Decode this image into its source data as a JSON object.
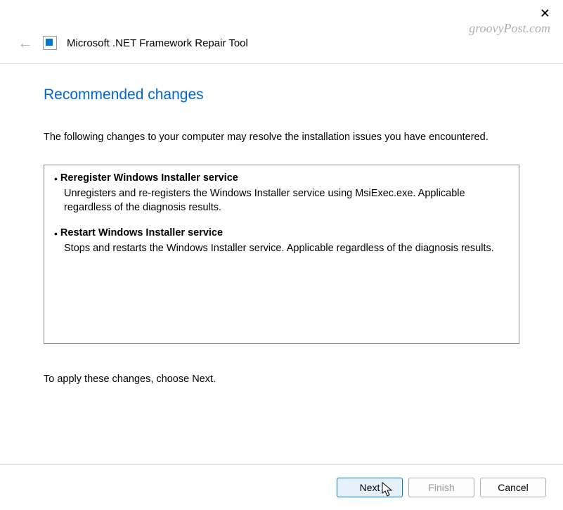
{
  "watermark": "groovyPost.com",
  "header": {
    "title": "Microsoft .NET Framework Repair Tool"
  },
  "page": {
    "heading": "Recommended changes",
    "intro": "The following changes to your computer may resolve the installation issues you have encountered.",
    "apply_text": "To apply these changes, choose Next."
  },
  "changes": [
    {
      "title": "Reregister Windows Installer service",
      "description": "Unregisters and re-registers the Windows Installer service using MsiExec.exe. Applicable regardless of the diagnosis results."
    },
    {
      "title": "Restart Windows Installer service",
      "description": "Stops and restarts the Windows Installer service. Applicable regardless of the diagnosis results."
    }
  ],
  "buttons": {
    "next": "Next",
    "finish": "Finish",
    "cancel": "Cancel"
  }
}
